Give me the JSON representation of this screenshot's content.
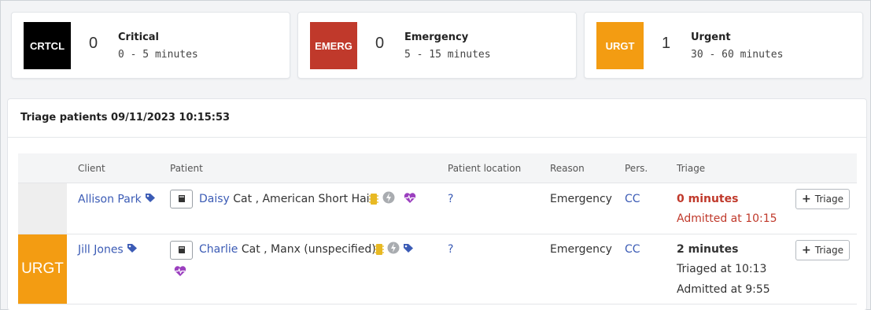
{
  "summary": [
    {
      "badge": "CRTCL",
      "count": "0",
      "label": "Critical",
      "range": "0 - 5 minutes",
      "color": "#000000"
    },
    {
      "badge": "EMERG",
      "count": "0",
      "label": "Emergency",
      "range": "5 - 15 minutes",
      "color": "#c0392b"
    },
    {
      "badge": "URGT",
      "count": "1",
      "label": "Urgent",
      "range": "30 - 60 minutes",
      "color": "#f39c12"
    }
  ],
  "panel": {
    "title": "Triage patients 09/11/2023 10:15:53",
    "columns": [
      "Client",
      "Patient",
      "Patient location",
      "Reason",
      "Pers.",
      "Triage"
    ]
  },
  "rows": [
    {
      "stripe_label": "",
      "stripe_color": "#eeeeee",
      "client": "Allison Park",
      "patient_name": "Daisy",
      "patient_desc": "Cat , American Short Hair",
      "location": "?",
      "reason": "Emergency",
      "pers": "CC",
      "triage_time": "0 minutes",
      "triage_line2": "Admitted at 10:15",
      "triage_btn": "Triage"
    },
    {
      "stripe_label": "URGT",
      "stripe_color": "#f39c12",
      "client": "Jill Jones",
      "patient_name": "Charlie",
      "patient_desc": "Cat , Manx (unspecified)",
      "location": "?",
      "reason": "Emergency",
      "pers": "CC",
      "triage_time": "2 minutes",
      "triage_line2": "Triaged at 10:13",
      "triage_line3": "Admitted at 9:55",
      "triage_btn": "Triage"
    }
  ],
  "icons": {
    "tag": "tag-icon",
    "book": "book-icon",
    "chip": "microchip-icon",
    "bolt": "bolt-icon",
    "heart": "heart-pulse-icon",
    "plus": "plus-icon"
  },
  "colors": {
    "link": "#3b5bb5",
    "heart": "#9b3fbf",
    "chip": "#e8b923",
    "bolt": "#a9acb0",
    "alert_red": "#c0392b"
  }
}
